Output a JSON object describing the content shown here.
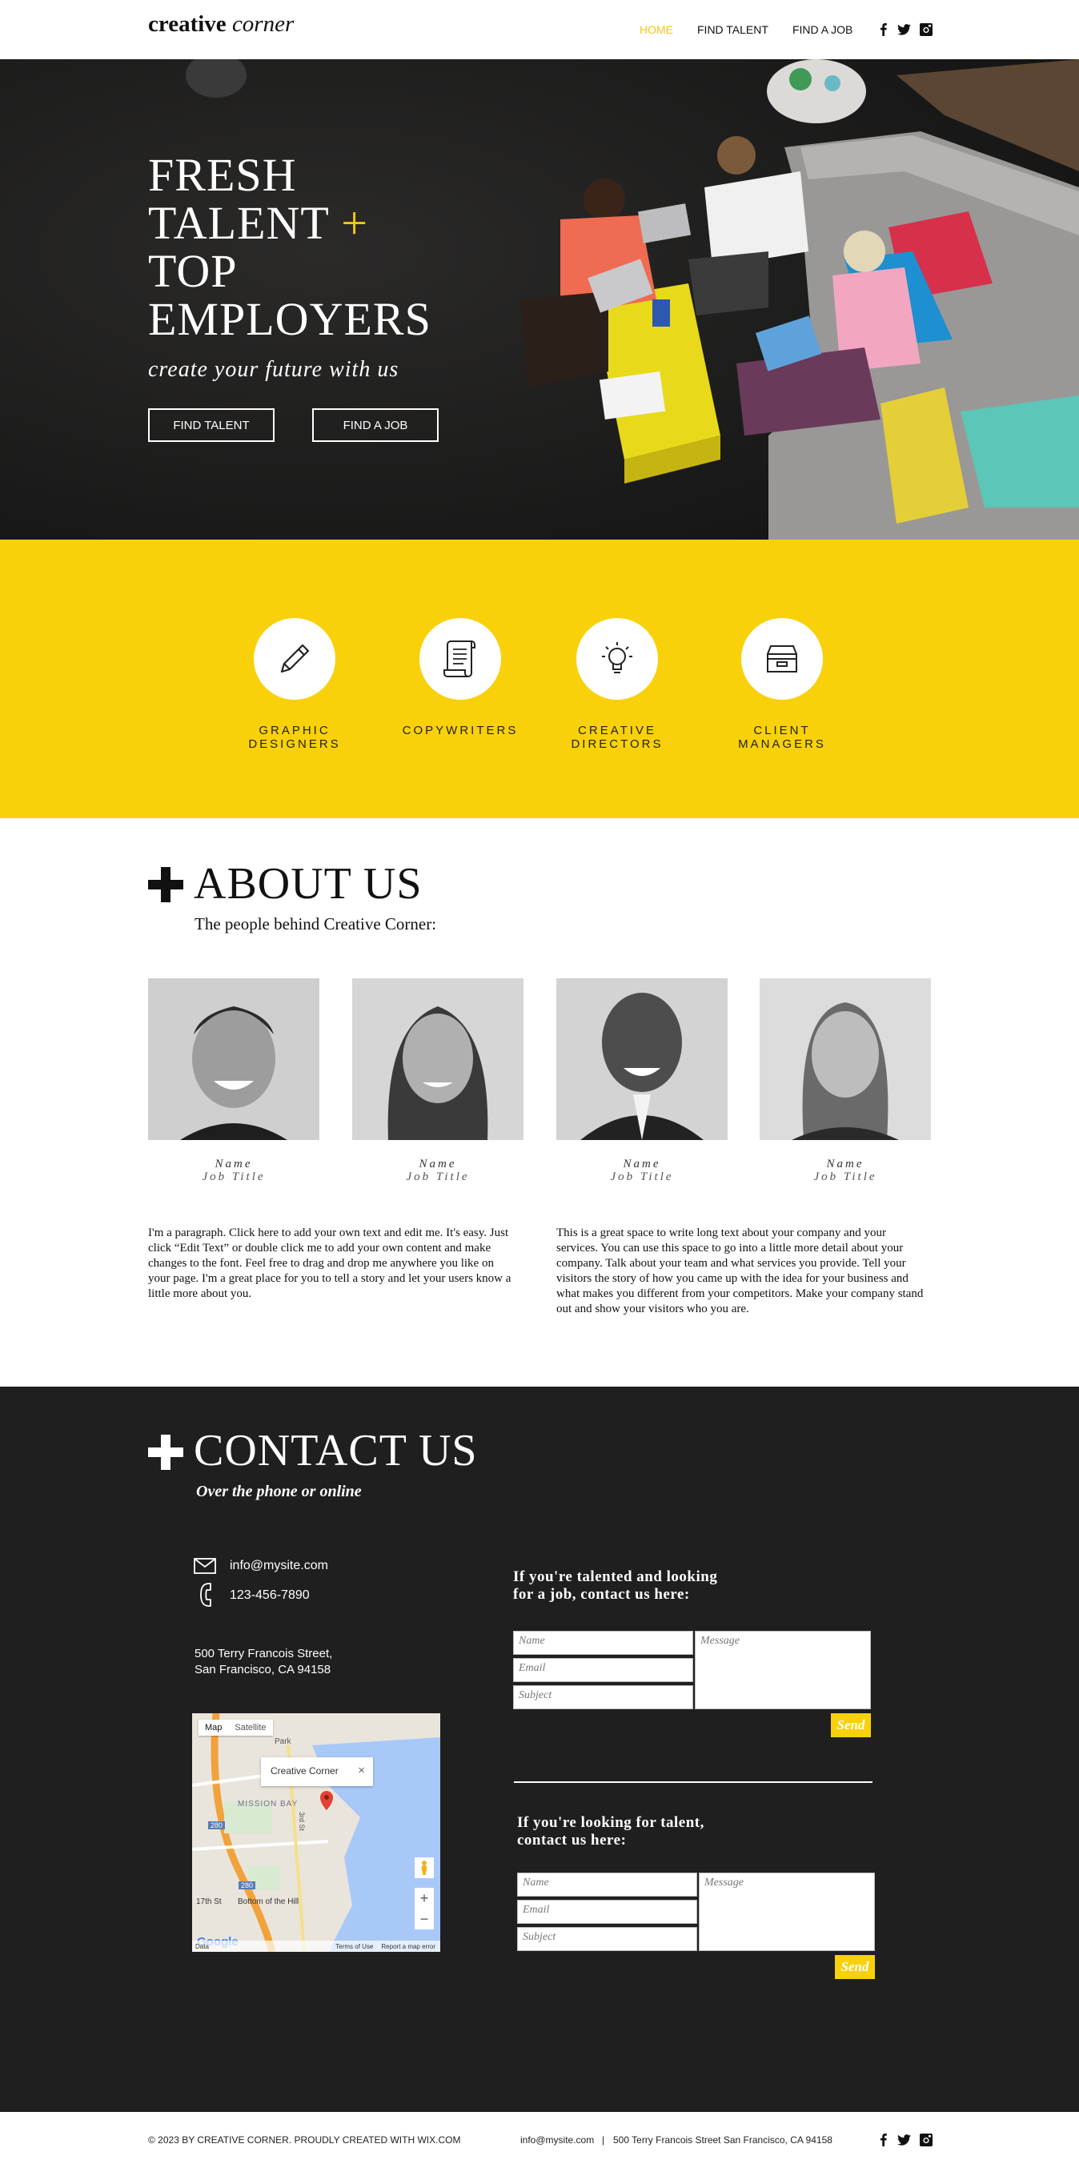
{
  "header": {
    "logo_bold": "creative",
    "logo_italic": "corner",
    "nav": [
      "HOME",
      "FIND TALENT",
      "FIND A JOB"
    ],
    "social": [
      "facebook-icon",
      "twitter-icon",
      "instagram-icon"
    ]
  },
  "hero": {
    "title_line1": "FRESH",
    "title_line2": "TALENT",
    "title_plus": "+",
    "title_line3": "TOP",
    "title_line4": "EMPLOYERS",
    "subtitle": "create your future with us",
    "btn_find_talent": "FIND TALENT",
    "btn_find_job": "FIND A JOB"
  },
  "roles": [
    {
      "label1": "GRAPHIC",
      "label2": "DESIGNERS",
      "icon": "pencil-icon"
    },
    {
      "label1": "COPYWRITERS",
      "label2": "",
      "icon": "scroll-icon"
    },
    {
      "label1": "CREATIVE",
      "label2": "DIRECTORS",
      "icon": "lightbulb-icon"
    },
    {
      "label1": "CLIENT",
      "label2": "MANAGERS",
      "icon": "archive-box-icon"
    }
  ],
  "about": {
    "title": "ABOUT US",
    "subtitle": "The people behind Creative Corner:",
    "team": [
      {
        "name": "Name",
        "job_title": "Job Title"
      },
      {
        "name": "Name",
        "job_title": "Job Title"
      },
      {
        "name": "Name",
        "job_title": "Job Title"
      },
      {
        "name": "Name",
        "job_title": "Job Title"
      }
    ],
    "para_left": "I'm a paragraph. Click here to add your own text and edit me. It's easy. Just click “Edit Text” or double click me to add your own content and make changes to the font. Feel free to drag and drop me anywhere you like on your page. I'm a great place for you to tell a story and let your users know a little more about you.",
    "para_right": "This is a great space to write long text about your company and your services. You can use this space to go into a little more detail about your company. Talk about your team and what services you provide. Tell your visitors the story of how you came up with the idea for your business and what makes you different from your competitors. Make your company stand out and show your visitors who you are."
  },
  "contact": {
    "title": "CONTACT US",
    "subtitle": "Over the phone or online",
    "email": "info@mysite.com",
    "phone": "123-456-7890",
    "address_line1": "500 Terry Francois Street,",
    "address_line2": "San Francisco, CA 94158",
    "map": {
      "tab_map": "Map",
      "tab_satellite": "Satellite",
      "popup": "Creative Corner",
      "label_mission_bay": "MISSION BAY",
      "label_park": "Park",
      "label_bottom_hill": "Bottom of the Hill",
      "label_17th": "17th St",
      "label_3rd": "3rd St",
      "label_280a": "280",
      "label_280b": "280",
      "google": "Google",
      "data": "Data",
      "terms": "Terms of Use",
      "report": "Report a map error"
    },
    "form1": {
      "heading_line1": "If you're talented and looking",
      "heading_line2": "for a job, contact us here:",
      "name": "Name",
      "email": "Email",
      "subject": "Subject",
      "message": "Message",
      "send": "Send"
    },
    "form2": {
      "heading_line1": "If you're looking for talent,",
      "heading_line2": "contact us here:",
      "name": "Name",
      "email": "Email",
      "subject": "Subject",
      "message": "Message",
      "send": "Send"
    }
  },
  "footer": {
    "copyright": "© 2023 BY CREATIVE CORNER. PROUDLY CREATED WITH WIX.COM",
    "email": "info@mysite.com",
    "separator": "|",
    "address": "500 Terry Francois Street San Francisco, CA 94158"
  },
  "colors": {
    "accent": "#f9d10b",
    "dark": "#1f1f1f",
    "nav_active": "#f2c90f"
  }
}
